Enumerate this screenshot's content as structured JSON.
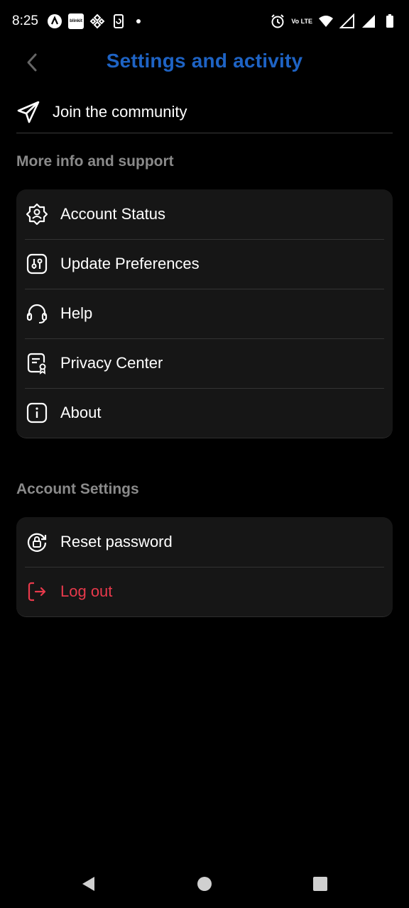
{
  "status_bar": {
    "time": "8:25",
    "left_icons": [
      "app-a-icon",
      "blinkit-icon",
      "binance-icon",
      "phone-sync-icon",
      "dot-icon"
    ],
    "blinkit_text": "blinkit",
    "lte_text": "Vo LTE",
    "right_icons": [
      "alarm-icon",
      "volte-icon",
      "wifi-icon",
      "signal-icon",
      "signal-icon",
      "battery-icon"
    ]
  },
  "header": {
    "title": "Settings and activity",
    "back_icon": "chevron-left-icon"
  },
  "join": {
    "label": "Join the community",
    "icon": "paper-plane-icon"
  },
  "support_section": {
    "title": "More info and support",
    "items": [
      {
        "label": "Account Status",
        "icon": "gear-badge-icon"
      },
      {
        "label": "Update Preferences",
        "icon": "sliders-icon"
      },
      {
        "label": "Help",
        "icon": "headset-icon"
      },
      {
        "label": "Privacy Center",
        "icon": "document-badge-icon"
      },
      {
        "label": "About",
        "icon": "info-icon"
      }
    ]
  },
  "account_section": {
    "title": "Account Settings",
    "items": [
      {
        "label": "Reset password",
        "icon": "lock-reset-icon"
      },
      {
        "label": "Log out",
        "icon": "logout-icon"
      }
    ]
  },
  "nav_bar": {
    "icons": [
      "back-triangle-icon",
      "home-circle-icon",
      "recents-square-icon"
    ]
  },
  "colors": {
    "background": "#000000",
    "title": "#1e63c4",
    "card": "#161616",
    "section_title": "#8a8a8a",
    "danger": "#e8394b"
  }
}
